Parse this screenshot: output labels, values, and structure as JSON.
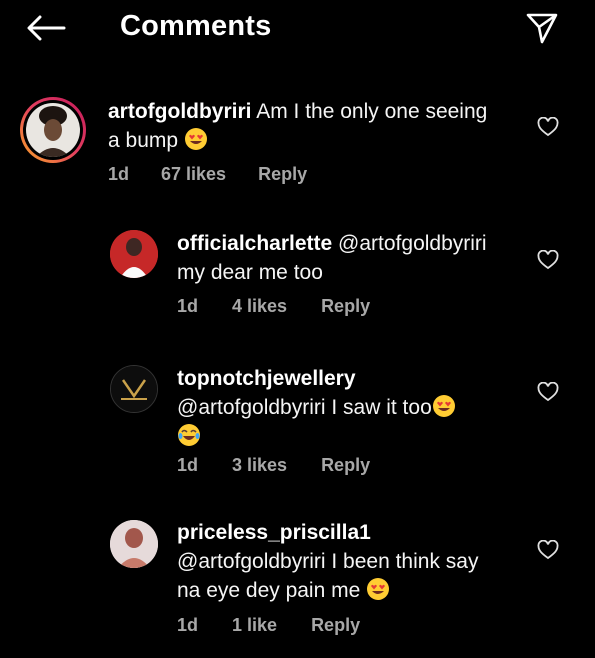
{
  "header": {
    "title": "Comments"
  },
  "comments": [
    {
      "username": "artofgoldbyriri",
      "text_line1": " Am I the only one seeing",
      "text_line2": "a bump ",
      "emoji": "heart-eyes-emoji",
      "time": "1d",
      "likes": "67 likes",
      "reply": "Reply"
    },
    {
      "username": "officialcharlette",
      "text_line1": " @artofgoldbyriri",
      "text_line2": "my dear me too",
      "time": "1d",
      "likes": "4 likes",
      "reply": "Reply"
    },
    {
      "username": "topnotchjewellery",
      "text_line1": "",
      "text_line2": "@artofgoldbyriri I saw it too",
      "emoji": "heart-eyes-emoji",
      "emoji2": "tears-of-joy-emoji",
      "time": "1d",
      "likes": "3 likes",
      "reply": "Reply"
    },
    {
      "username": "priceless_priscilla1",
      "text_line1": "",
      "text_line2": "@artofgoldbyriri  I been think say",
      "text_line3": "na eye dey pain me ",
      "emoji": "heart-eyes-emoji",
      "time": "1d",
      "likes": "1 like",
      "reply": "Reply"
    }
  ],
  "icons": {
    "back": "arrow-left-icon",
    "send": "send-icon",
    "like": "heart-outline-icon"
  },
  "colors": {
    "background": "#000000",
    "text": "#f5f5f5",
    "meta": "#a8a8a8",
    "story_ring_start": "#f9a825",
    "story_ring_end": "#c2185b"
  }
}
